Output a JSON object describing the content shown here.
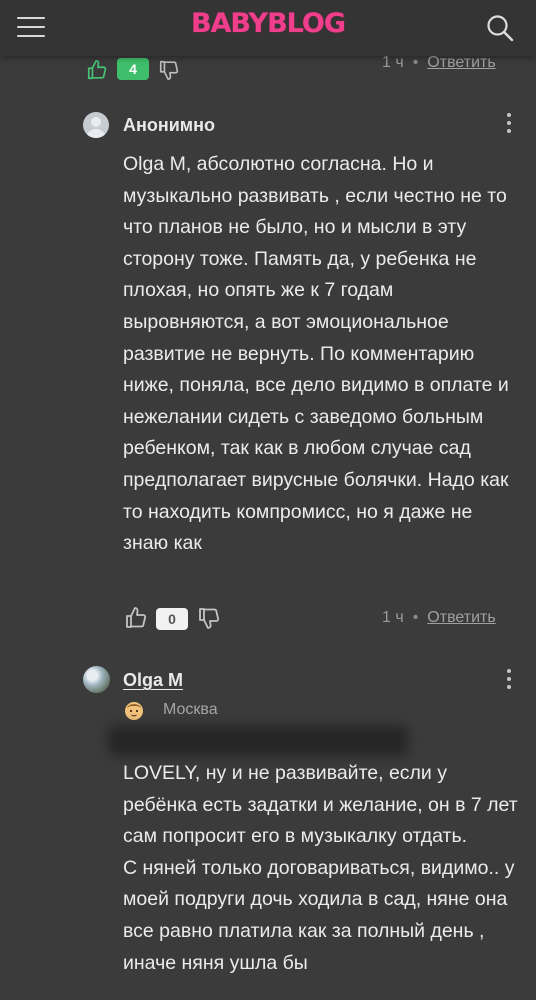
{
  "header": {
    "logo": "BABYBLOG",
    "menu_icon": "hamburger-icon",
    "search_icon": "search-icon"
  },
  "comments": [
    {
      "likes": "4",
      "time": "1 ч",
      "reply_label": "Ответить"
    },
    {
      "author": "Анонимно",
      "text": "Olga M, абсолютно согласна. Но и музыкально развивать , если честно не то что планов не было, но и мысли в эту сторону тоже. Память да, у ребенка не плохая, но опять же к 7 годам выровняются, а вот эмоциональное развитие не вернуть. По комментарию ниже, поняла, все дело видимо в оплате и нежелании сидеть с заведомо больным ребенком, так как в любом случае сад предполагает вирусные болячки. Надо как то находить компромисс, но я даже не знаю как",
      "likes": "0",
      "time": "1 ч",
      "reply_label": "Ответить"
    },
    {
      "author": "Olga M",
      "location": "Москва",
      "paragraphs": [
        "LOVELY, ну и не развивайте, если у ребёнка есть задатки и желание, он в 7 лет сам попросит его в музыкалку отдать.",
        "С няней только договариваться, видимо.. у моей подруги дочь ходила в сад, няне она все равно платила как за полный день , иначе няня ушла бы"
      ]
    }
  ],
  "colors": {
    "background": "#3b3b3b",
    "header": "#343434",
    "logo": "#ef3f8c",
    "likes_positive": "#3fbf6b"
  }
}
